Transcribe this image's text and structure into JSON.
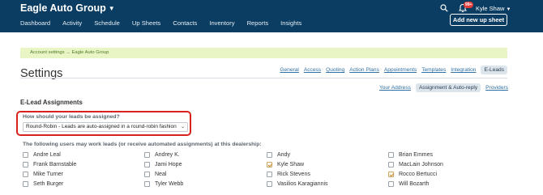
{
  "header": {
    "brand": "Eagle Auto Group",
    "nav": [
      "Dashboard",
      "Activity",
      "Schedule",
      "Up Sheets",
      "Contacts",
      "Inventory",
      "Reports",
      "Insights"
    ],
    "notification_count": "99+",
    "user_name": "Kyle Shaw",
    "add_button": "Add new up sheet"
  },
  "breadcrumb": "Account settings → Eagle Auto Group",
  "page_title": "Settings",
  "tabs": [
    "General",
    "Access",
    "Quoting",
    "Action Plans",
    "Appointments",
    "Templates",
    "Integration",
    "E-Leads"
  ],
  "active_tab": "E-Leads",
  "subtabs": [
    "Your Address",
    "Assignment & Auto-reply",
    "Providers"
  ],
  "active_subtab": "Assignment & Auto-reply",
  "section_title": "E-Lead Assignments",
  "assignment": {
    "question": "How should your leads be assigned?",
    "selected": "Round-Robin - Leads are auto-assigned in a round-robin fashion"
  },
  "users_label": "The following users may work leads (or receive automated assignments) at this dealership:",
  "users": [
    [
      {
        "name": "Andre Leal",
        "checked": false
      },
      {
        "name": "Frank Barnstable",
        "checked": false
      },
      {
        "name": "Mike Turner",
        "checked": false
      },
      {
        "name": "Seth Burger",
        "checked": false
      }
    ],
    [
      {
        "name": "Andrey K.",
        "checked": false
      },
      {
        "name": "Jami Hope",
        "checked": false
      },
      {
        "name": "Neal",
        "checked": false
      },
      {
        "name": "Tyler Webb",
        "checked": false
      }
    ],
    [
      {
        "name": "Andy",
        "checked": false
      },
      {
        "name": "Kyle Shaw",
        "checked": true
      },
      {
        "name": "Rick Stevens",
        "checked": false
      },
      {
        "name": "Vasilios Karagiannis",
        "checked": false
      }
    ],
    [
      {
        "name": "Brian Emmes",
        "checked": false
      },
      {
        "name": "MacLain Johnson",
        "checked": false
      },
      {
        "name": "Rocco Bertucci",
        "checked": true
      },
      {
        "name": "Will Bozarth",
        "checked": false
      }
    ]
  ],
  "colors": {
    "header_bg": "#0b3d62",
    "accent_red": "#d9221c",
    "breadcrumb_bg": "#eaf5c6",
    "link": "#2f6fa3"
  }
}
